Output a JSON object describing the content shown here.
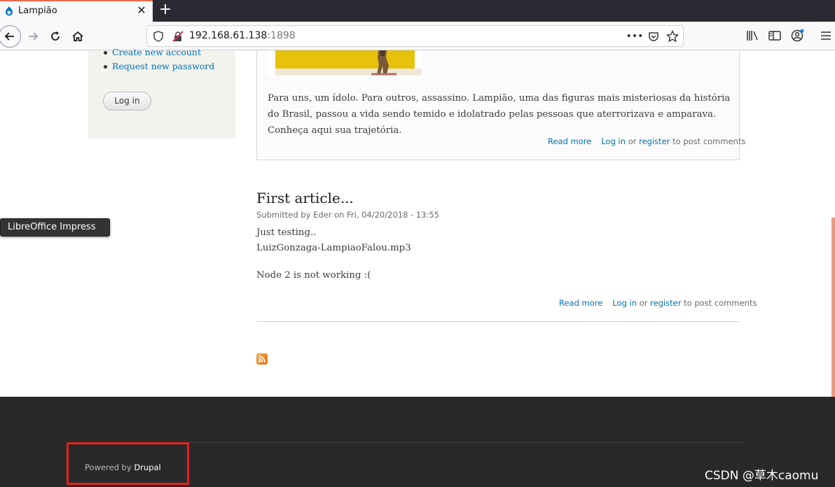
{
  "browser": {
    "tab_title": "Lampião",
    "tab_close": "✕",
    "new_tab": "+",
    "url_host": "192.168.61.138",
    "url_port": ":1898",
    "page_actions": "•••"
  },
  "sidebar": {
    "links": [
      "Create new account",
      "Request new password"
    ],
    "login_button": "Log in"
  },
  "article1": {
    "body": "Para uns, um ídolo. Para outros, assassino. Lampião, uma das figuras mais misteriosas da história do Brasil, passou a vida sendo temido e idolatrado pelas pessoas que aterrorizava e amparava. Conheça aqui sua trajetória.",
    "read_more": "Read more",
    "log_in": "Log in",
    "or": "or",
    "register": "register",
    "post_comments": "to post comments"
  },
  "article2": {
    "title": "First article...",
    "meta": "Submitted by Eder on Fri, 04/20/2018 - 13:55",
    "line1": "Just testing..",
    "line2": "LuizGonzaga-LampiaoFalou.mp3",
    "line3": "Node 2 is not working :(",
    "read_more": "Read more",
    "log_in": "Log in",
    "or": "or",
    "register": "register",
    "post_comments": "to post comments"
  },
  "tooltip": "LibreOffice Impress",
  "footer": {
    "powered_by": "Powered by",
    "drupal": "Drupal"
  },
  "watermark": "CSDN @草木caomu"
}
